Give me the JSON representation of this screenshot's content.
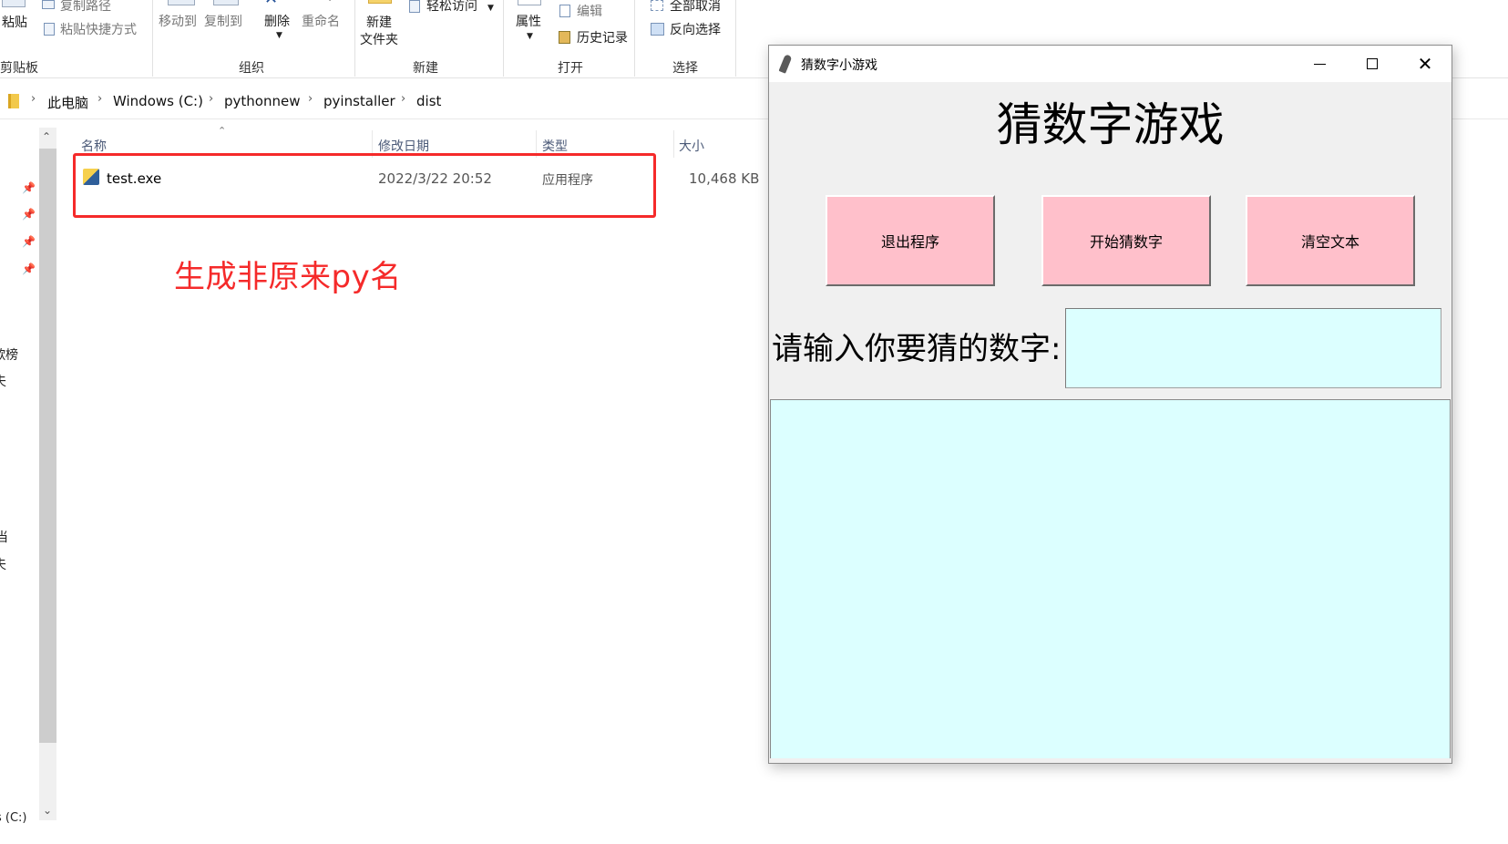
{
  "ribbon": {
    "paste": "粘贴",
    "copy_path": "复制路径",
    "paste_shortcut": "粘贴快捷方式",
    "move_to": "移动到",
    "copy_to": "复制到",
    "delete": "删除",
    "rename": "重命名",
    "new_folder_line1": "新建",
    "new_folder_line2": "文件夹",
    "easy_access": "轻松访问",
    "properties": "属性",
    "edit": "编辑",
    "history": "历史记录",
    "select_all": "全部取消",
    "invert_selection": "反向选择",
    "groups": {
      "clipboard": "剪贴板",
      "organize": "组织",
      "new": "新建",
      "open": "打开",
      "select": "选择"
    }
  },
  "breadcrumb": [
    "此电脑",
    "Windows (C:)",
    "pythonnew",
    "pyinstaller",
    "dist"
  ],
  "file_list": {
    "columns": {
      "name": "名称",
      "date": "修改日期",
      "type": "类型",
      "size": "大小"
    },
    "rows": [
      {
        "name": "test.exe",
        "date": "2022/3/22 20:52",
        "type": "应用程序",
        "size": "10,468 KB"
      }
    ]
  },
  "left_pane": {
    "frag1": "歌榜",
    "frag2": "夫",
    "frag3": "当",
    "frag4": "夫",
    "drive": "s (C:)"
  },
  "annotation": "生成非原来py名",
  "tk_window": {
    "title": "猜数字小游戏",
    "heading": "猜数字游戏",
    "buttons": {
      "quit": "退出程序",
      "start": "开始猜数字",
      "clear": "清空文本"
    },
    "prompt": "请输入你要猜的数字:",
    "entry_value": "",
    "text_value": ""
  },
  "colors": {
    "button_bg": "#ffc0cb",
    "input_bg": "#dcffff",
    "annotation": "#f52a2a"
  }
}
